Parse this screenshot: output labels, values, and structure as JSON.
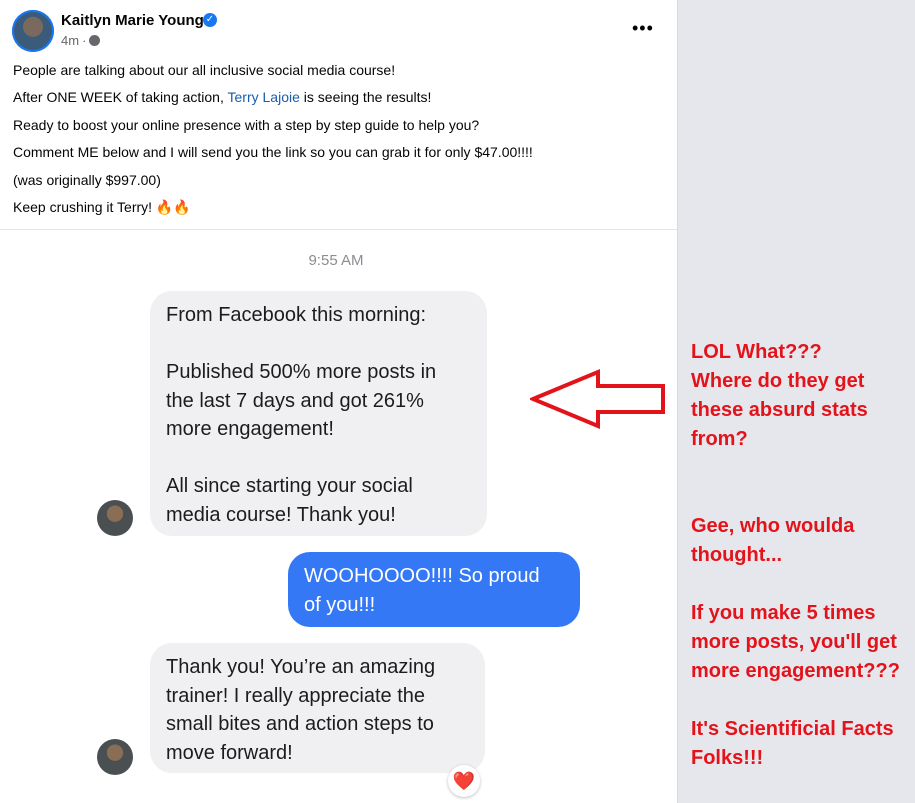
{
  "post": {
    "author": "Kaitlyn Marie Young",
    "time": "4m",
    "more_label": "•••",
    "lines": [
      "People are talking about our all inclusive social media course!",
      "is seeing the results!",
      "Ready to boost your online presence with a step by step guide to help you?",
      "Comment ME below and I will send you the link so you can grab it for only $47.00!!!!",
      "(was originally $997.00)",
      "Keep crushing it Terry! 🔥🔥"
    ],
    "line2_prefix": "After ONE WEEK of taking action,",
    "tagged_user": "Terry Lajoie",
    "icons": {
      "verified": "verified-badge-icon",
      "privacy": "globe-icon",
      "more": "more-options-icon"
    }
  },
  "chat": {
    "timestamp": "9:55 AM",
    "messages": [
      {
        "direction": "incoming",
        "paragraphs": [
          [
            "From Facebook this morning:"
          ],
          [
            "Published 500% more posts in",
            "the last 7 days and got 261%",
            "more engagement!"
          ],
          [
            "All since starting your social",
            "media course! Thank you!"
          ]
        ]
      },
      {
        "direction": "outgoing",
        "lines": [
          "WOOHOOOO!!!! So proud",
          "of you!!!"
        ]
      },
      {
        "direction": "incoming",
        "lines": [
          "Thank you! You’re an amazing",
          "trainer! I really appreciate the",
          "small bites and action steps to",
          "move forward!"
        ],
        "reaction": "❤️"
      }
    ]
  },
  "annotations": [
    [
      "LOL What???",
      "Where do they get",
      "these absurd stats",
      "from?"
    ],
    [
      "Gee, who woulda",
      "thought..."
    ],
    [
      "If you make 5 times",
      "more posts, you'll get",
      "more engagement???"
    ],
    [
      "It's Scientificial Facts",
      "Folks!!!"
    ]
  ],
  "colors": {
    "annotation": "#e3131b",
    "outgoing_bubble": "#3578f6",
    "incoming_bubble": "#f0f0f2",
    "link": "#1a5dab",
    "side_panel": "#e5e7ec"
  }
}
